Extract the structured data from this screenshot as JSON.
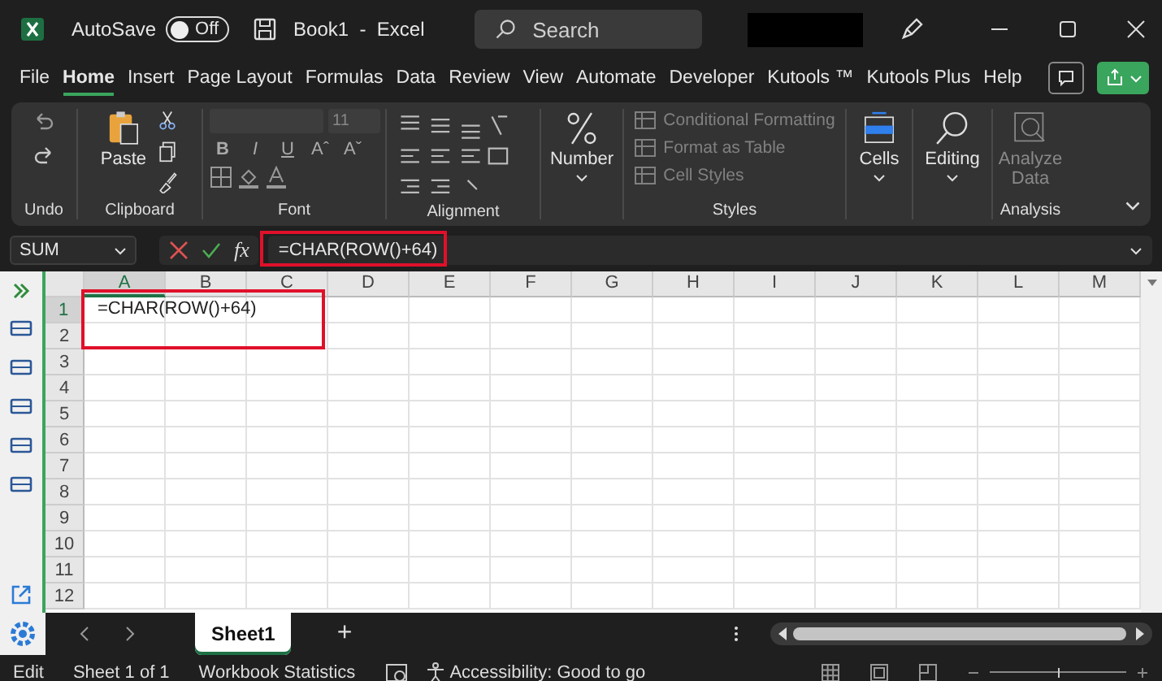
{
  "title_bar": {
    "autosave_label": "AutoSave",
    "autosave_toggle": {
      "label": "Off",
      "on": false
    },
    "document_title": "Book1  -  Excel",
    "search_placeholder": "Search"
  },
  "menu": [
    {
      "label": "File",
      "selected": false
    },
    {
      "label": "Home",
      "selected": true
    },
    {
      "label": "Insert",
      "selected": false
    },
    {
      "label": "Page Layout",
      "selected": false
    },
    {
      "label": "Formulas",
      "selected": false
    },
    {
      "label": "Data",
      "selected": false
    },
    {
      "label": "Review",
      "selected": false
    },
    {
      "label": "View",
      "selected": false
    },
    {
      "label": "Automate",
      "selected": false
    },
    {
      "label": "Developer",
      "selected": false
    },
    {
      "label": "Kutools ™",
      "selected": false
    },
    {
      "label": "Kutools Plus",
      "selected": false
    },
    {
      "label": "Help",
      "selected": false
    }
  ],
  "ribbon": {
    "groups": [
      {
        "kind": "undo",
        "label": "Undo"
      },
      {
        "kind": "clipboard",
        "label": "Clipboard",
        "button": "Paste"
      },
      {
        "kind": "font",
        "label": "Font",
        "size": "11",
        "buttons": [
          "B",
          "I",
          "U",
          "Aˆ",
          "Aˇ"
        ]
      },
      {
        "kind": "alignment",
        "label": "Alignment"
      },
      {
        "kind": "number",
        "button": "Number"
      },
      {
        "kind": "styles",
        "label": "Styles",
        "items": [
          {
            "label": "Conditional Formatting",
            "disabled": true
          },
          {
            "label": "Format as Table",
            "disabled": true
          },
          {
            "label": "Cell Styles",
            "disabled": true
          }
        ]
      },
      {
        "kind": "cells",
        "button": "Cells"
      },
      {
        "kind": "editing",
        "button": "Editing"
      },
      {
        "kind": "analysis",
        "label": "Analysis",
        "button": "Analyze Data",
        "disabled": true
      }
    ]
  },
  "formula_bar": {
    "name_box": "SUM",
    "fx": "fx",
    "formula": "=CHAR(ROW()+64)"
  },
  "sheet": {
    "columns": [
      {
        "label": "A",
        "selected": true
      },
      {
        "label": "B",
        "selected": false
      },
      {
        "label": "C",
        "selected": false
      },
      {
        "label": "D",
        "selected": false
      },
      {
        "label": "E",
        "selected": false
      },
      {
        "label": "F",
        "selected": false
      },
      {
        "label": "G",
        "selected": false
      },
      {
        "label": "H",
        "selected": false
      },
      {
        "label": "I",
        "selected": false
      },
      {
        "label": "J",
        "selected": false
      },
      {
        "label": "K",
        "selected": false
      },
      {
        "label": "L",
        "selected": false
      },
      {
        "label": "M",
        "selected": false
      }
    ],
    "rows": [
      {
        "label": "1",
        "selected": true,
        "cells": [
          "=CHAR(ROW()+64)"
        ]
      },
      {
        "label": "2",
        "selected": false,
        "cells": []
      },
      {
        "label": "3",
        "selected": false,
        "cells": []
      },
      {
        "label": "4",
        "selected": false,
        "cells": []
      },
      {
        "label": "5",
        "selected": false,
        "cells": []
      },
      {
        "label": "6",
        "selected": false,
        "cells": []
      },
      {
        "label": "7",
        "selected": false,
        "cells": []
      },
      {
        "label": "8",
        "selected": false,
        "cells": []
      },
      {
        "label": "9",
        "selected": false,
        "cells": []
      },
      {
        "label": "10",
        "selected": false,
        "cells": []
      },
      {
        "label": "11",
        "selected": false,
        "cells": []
      },
      {
        "label": "12",
        "selected": false,
        "cells": []
      }
    ]
  },
  "sheet_tabs": [
    {
      "label": "Sheet1",
      "selected": true
    }
  ],
  "add_sheet": "+",
  "status_bar": {
    "mode": "Edit",
    "sheet_count": "Sheet 1 of 1",
    "statistics": "Workbook Statistics",
    "accessibility": "Accessibility: Good to go",
    "zoom_slider": {
      "level": 0.5
    }
  }
}
